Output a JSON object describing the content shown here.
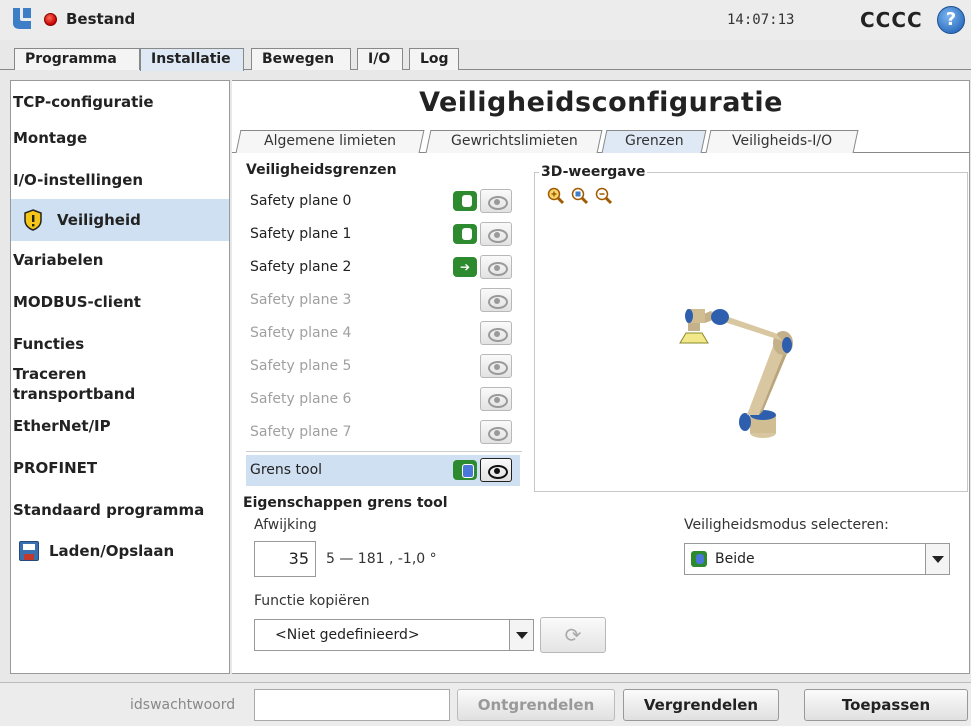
{
  "titlebar": {
    "app_title": "Bestand",
    "time": "14:07:13",
    "robot_name": "CCCC",
    "help_symbol": "?",
    "logo_icon": "ur-logo",
    "status_icon": "red-stop-dot",
    "help_icon": "help-icon"
  },
  "main_tabs": [
    {
      "label": "Programma",
      "active": false
    },
    {
      "label": "Installatie",
      "active": true
    },
    {
      "label": "Bewegen",
      "active": false
    },
    {
      "label": "I/O",
      "active": false
    },
    {
      "label": "Log",
      "active": false
    }
  ],
  "sidebar": {
    "items": [
      {
        "label": "TCP-configuratie"
      },
      {
        "label": "Montage"
      },
      {
        "label": "I/O-instellingen"
      },
      {
        "label": "Veiligheid",
        "active": true,
        "icon": "shield-warning-icon"
      },
      {
        "label": "Variabelen"
      },
      {
        "label": "MODBUS-client"
      },
      {
        "label": "Functies"
      },
      {
        "label": "Traceren transportband"
      },
      {
        "label": "EtherNet/IP"
      },
      {
        "label": "PROFINET"
      },
      {
        "label": "Standaard programma"
      },
      {
        "label": "Laden/Opslaan",
        "icon": "floppy-disk-icon"
      }
    ]
  },
  "main": {
    "title": "Veiligheidsconfiguratie",
    "subtabs": [
      {
        "label": "Algemene limieten",
        "active": false
      },
      {
        "label": "Gewrichtslimieten",
        "active": false
      },
      {
        "label": "Grenzen",
        "active": true
      },
      {
        "label": "Veiligheids-I/O",
        "active": false
      }
    ],
    "boundaries": {
      "title": "Veiligheidsgrenzen",
      "planes": [
        {
          "label": "Safety plane 0",
          "enabled": true,
          "mode": "normal"
        },
        {
          "label": "Safety plane 1",
          "enabled": true,
          "mode": "normal"
        },
        {
          "label": "Safety plane 2",
          "enabled": true,
          "mode": "trigger-reduced"
        },
        {
          "label": "Safety plane 3",
          "enabled": false
        },
        {
          "label": "Safety plane 4",
          "enabled": false
        },
        {
          "label": "Safety plane 5",
          "enabled": false
        },
        {
          "label": "Safety plane 6",
          "enabled": false
        },
        {
          "label": "Safety plane 7",
          "enabled": false
        }
      ],
      "tool_boundary": {
        "label": "Grens tool",
        "enabled": true,
        "visible": true
      }
    },
    "view3d": {
      "title": "3D-weergave",
      "zoom_icons": [
        "zoom-in-icon",
        "zoom-fit-icon",
        "zoom-out-icon"
      ]
    },
    "tool_props": {
      "title": "Eigenschappen grens tool",
      "deviation_label": "Afwijking",
      "deviation_value": "35",
      "deviation_range": "5 — 181 , -1,0 °",
      "mode_label": "Veiligheidsmodus selecteren:",
      "mode_value": "Beide",
      "copy_label": "Functie kopiëren",
      "copy_value": "<Niet gedefinieerd>"
    }
  },
  "bottombar": {
    "password_label": "idswachtwoord",
    "password_value": "",
    "unlock_label": "Ontgrendelen",
    "lock_label": "Vergrendelen",
    "apply_label": "Toepassen"
  },
  "colors": {
    "selection": "#cfe0f2",
    "enabled_green": "#2e8a2e",
    "reduced_blue": "#4a78d8",
    "stop_red": "#c40000"
  }
}
